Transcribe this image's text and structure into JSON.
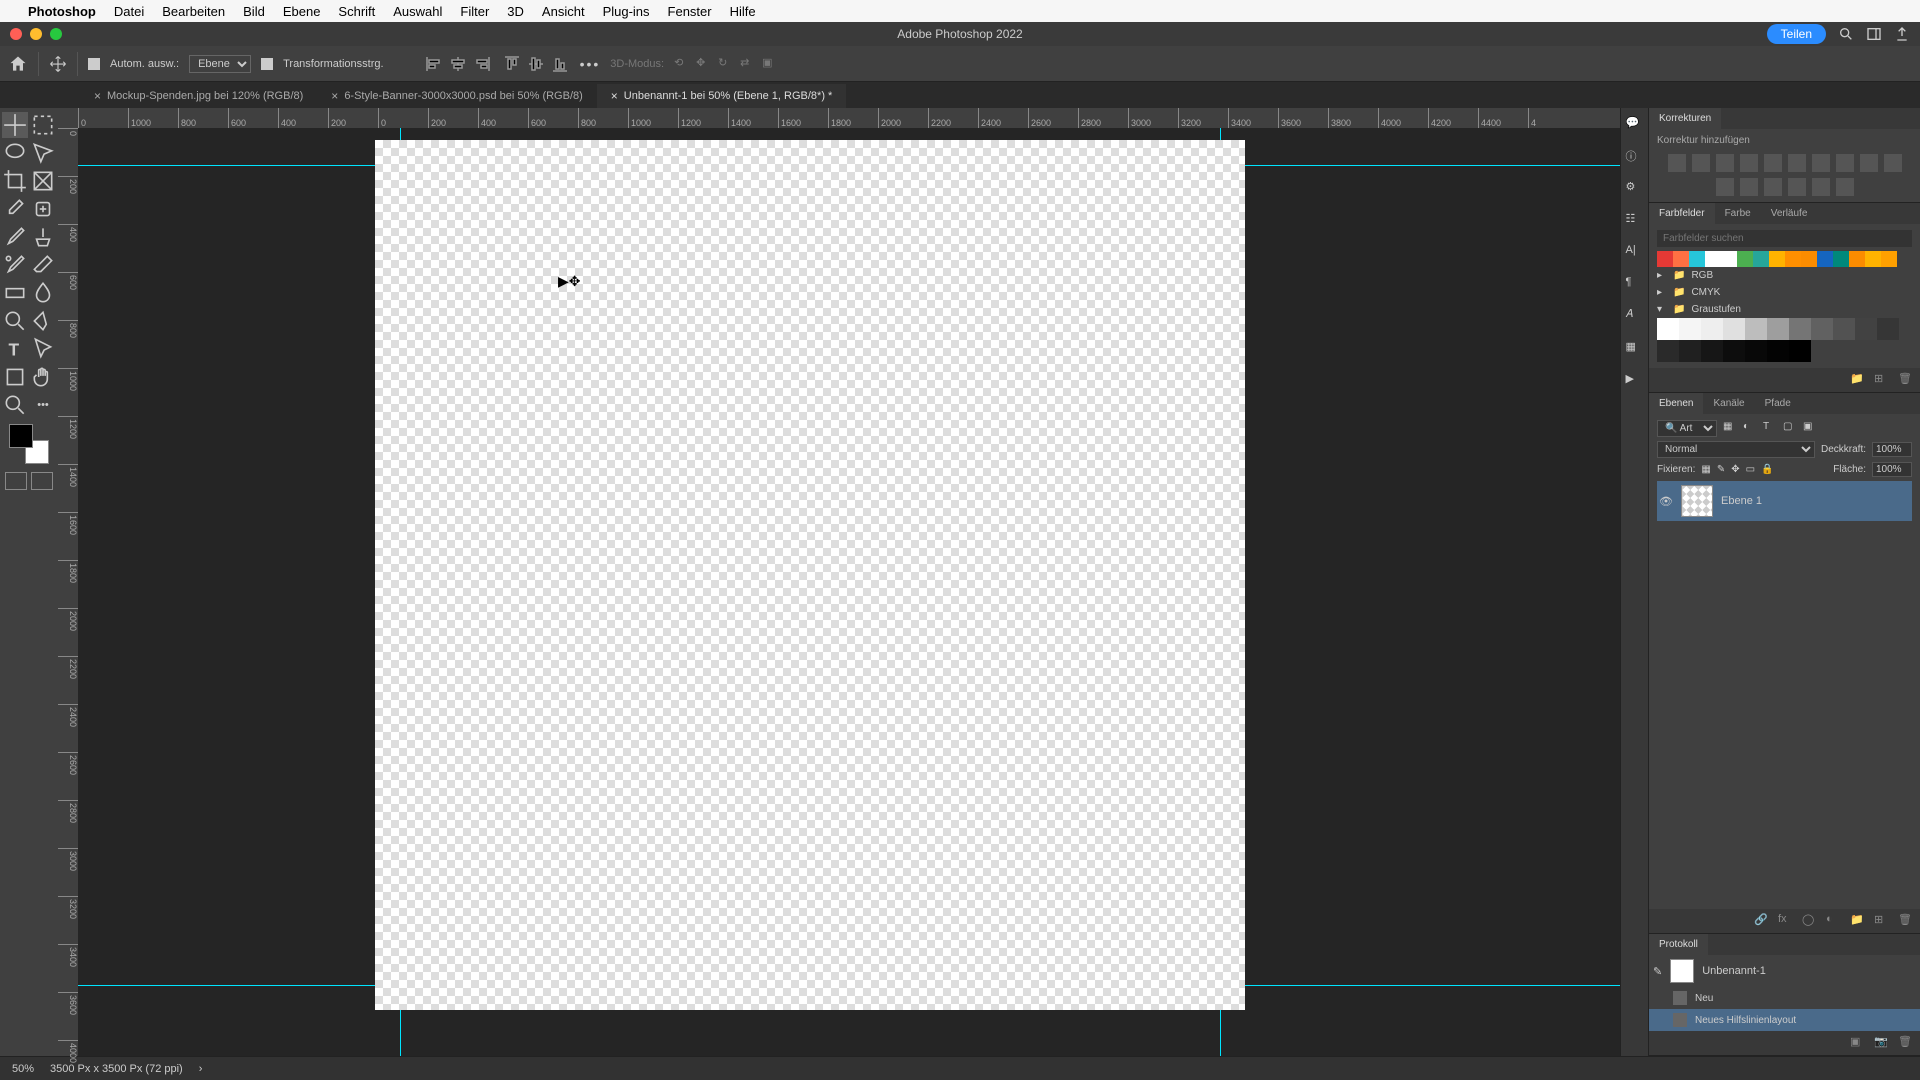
{
  "mac_menu": {
    "app": "Photoshop",
    "items": [
      "Datei",
      "Bearbeiten",
      "Bild",
      "Ebene",
      "Schrift",
      "Auswahl",
      "Filter",
      "3D",
      "Ansicht",
      "Plug-ins",
      "Fenster",
      "Hilfe"
    ]
  },
  "titlebar": {
    "title": "Adobe Photoshop 2022",
    "share": "Teilen"
  },
  "options": {
    "auto_select": "Autom. ausw.:",
    "layer_target": "Ebene",
    "transform_ctrls": "Transformationsstrg.",
    "mode3d": "3D-Modus:"
  },
  "tabs": [
    {
      "label": "Mockup-Spenden.jpg bei 120% (RGB/8)",
      "active": false
    },
    {
      "label": "6-Style-Banner-3000x3000.psd bei 50% (RGB/8)",
      "active": false
    },
    {
      "label": "Unbenannt-1 bei 50% (Ebene 1, RGB/8*) *",
      "active": true
    }
  ],
  "ruler_h": [
    "0",
    "1000",
    "800",
    "600",
    "400",
    "200",
    "0",
    "200",
    "400",
    "600",
    "800",
    "1000",
    "1200",
    "1400",
    "1600",
    "1800",
    "2000",
    "2200",
    "2400",
    "2600",
    "2800",
    "3000",
    "3200",
    "3400",
    "3600",
    "3800",
    "4000",
    "4200",
    "4400",
    "4"
  ],
  "ruler_v": [
    "0",
    "200",
    "400",
    "600",
    "800",
    "1000",
    "1200",
    "1400",
    "1600",
    "1800",
    "2000",
    "2200",
    "2400",
    "2600",
    "2800",
    "3000",
    "3200",
    "3400",
    "3600",
    "4000"
  ],
  "panels": {
    "adjustments": {
      "title": "Korrekturen",
      "add": "Korrektur hinzufügen"
    },
    "swatches": {
      "tabs": [
        "Farbfelder",
        "Farbe",
        "Verläufe"
      ],
      "search": "Farbfelder suchen",
      "groups": [
        "RGB",
        "CMYK",
        "Graustufen"
      ]
    },
    "layers": {
      "tabs": [
        "Ebenen",
        "Kanäle",
        "Pfade"
      ],
      "filter_kind": "Art",
      "blend": "Normal",
      "opacity_lbl": "Deckkraft:",
      "opacity": "100%",
      "lock_lbl": "Fixieren:",
      "fill_lbl": "Fläche:",
      "fill": "100%",
      "layer_name": "Ebene 1"
    },
    "history": {
      "title": "Protokoll",
      "doc": "Unbenannt-1",
      "items": [
        "Neu",
        "Neues Hilfslinienlayout"
      ]
    }
  },
  "status": {
    "zoom": "50%",
    "doc_info": "3500 Px x 3500 Px (72 ppi)"
  },
  "swatch_colors": [
    "#e53935",
    "#ff7043",
    "#26c6da",
    "#ffffff",
    "#ffffff",
    "#4caf50",
    "#26a69a",
    "#ffb300",
    "#ff8f00",
    "#fb8c00",
    "#1565c0",
    "#00897b",
    "#fb8c00",
    "#ffb300",
    "#ffa000"
  ],
  "gray_scale": [
    "#ffffff",
    "#f5f5f5",
    "#eeeeee",
    "#e0e0e0",
    "#bdbdbd",
    "#9e9e9e",
    "#757575",
    "#616161",
    "#525252",
    "#424242",
    "#363636",
    "#2a2a2a",
    "#202020",
    "#161616",
    "#0d0d0d",
    "#080808",
    "#030303",
    "#000000"
  ]
}
